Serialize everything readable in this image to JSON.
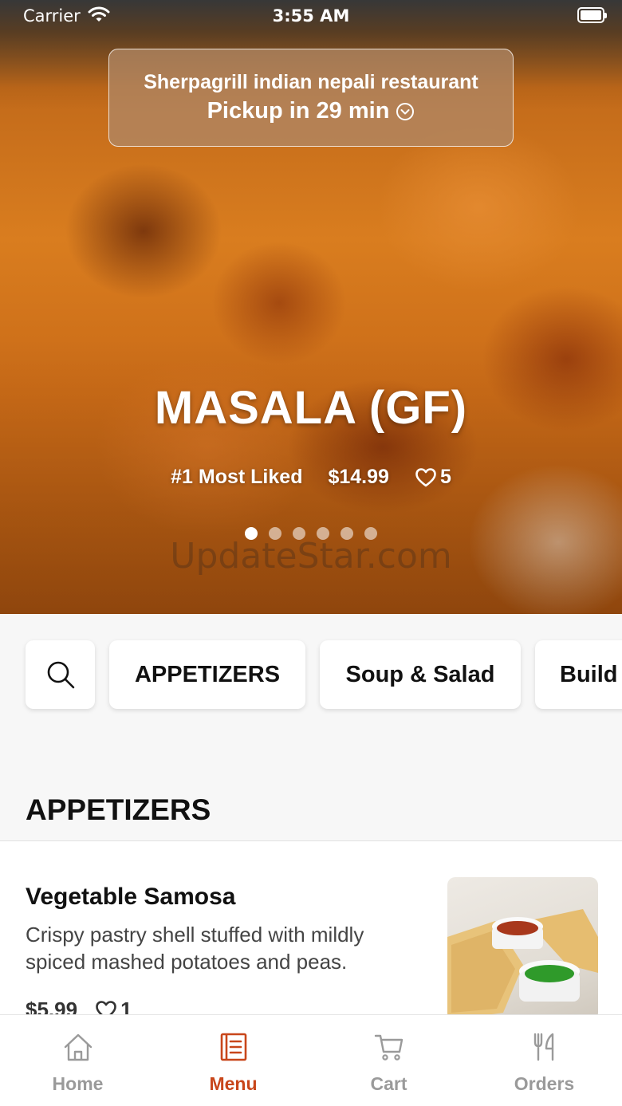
{
  "status_bar": {
    "carrier": "Carrier",
    "time": "3:55 AM"
  },
  "hero": {
    "restaurant_name": "Sherpagrill indian nepali restaurant",
    "pickup": "Pickup in 29 min",
    "title": "MASALA (GF)",
    "rank": "#1 Most Liked",
    "price": "$14.99",
    "likes": "5",
    "carousel": {
      "total": 6,
      "active_index": 0
    },
    "watermark": "UpdateStar.com"
  },
  "categories": {
    "search_icon": "search-icon",
    "items": [
      "APPETIZERS",
      "Soup & Salad",
      "Build"
    ]
  },
  "section": {
    "title": "APPETIZERS"
  },
  "menu_items": [
    {
      "name": "Vegetable Samosa",
      "description": "Crispy pastry shell stuffed with mildly spiced mashed potatoes and peas.",
      "price": "$5.99",
      "likes": "1"
    }
  ],
  "tab_bar": {
    "tabs": [
      {
        "label": "Home",
        "icon": "home-icon",
        "active": false
      },
      {
        "label": "Menu",
        "icon": "menu-icon",
        "active": true
      },
      {
        "label": "Cart",
        "icon": "cart-icon",
        "active": false
      },
      {
        "label": "Orders",
        "icon": "fork-knife-icon",
        "active": false
      }
    ],
    "active_color": "#c8461a",
    "inactive_color": "#9a9a9a"
  }
}
